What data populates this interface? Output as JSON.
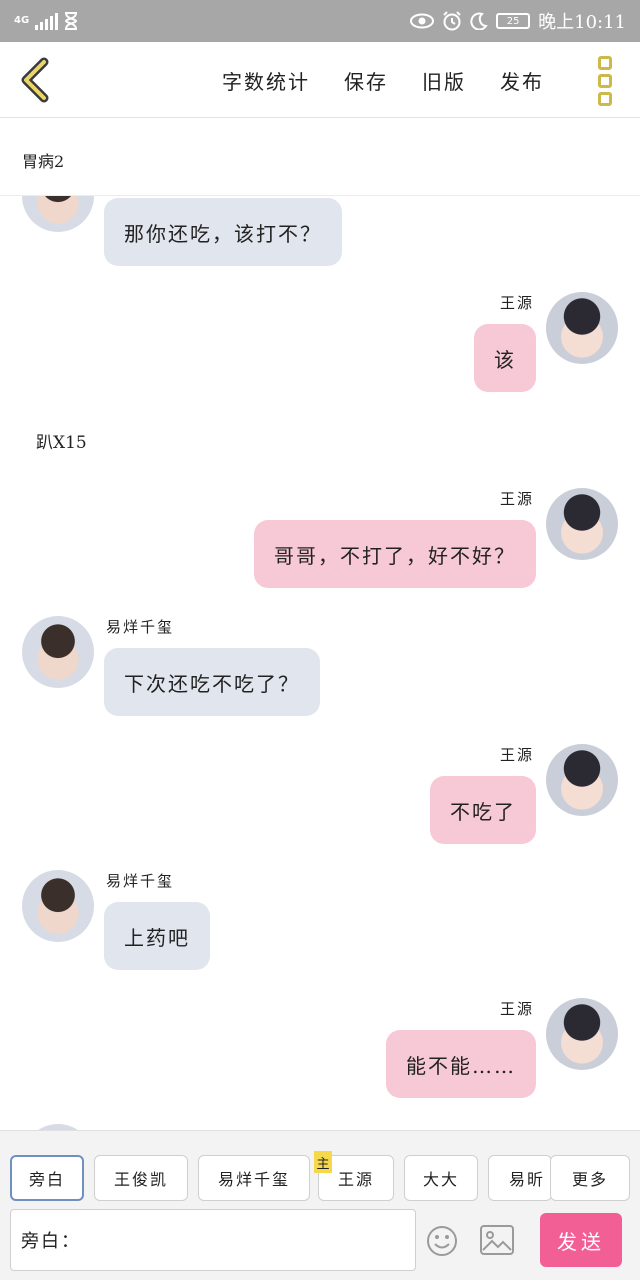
{
  "status_bar": {
    "network": "4G",
    "battery": "25",
    "time": "晚上10:11"
  },
  "header": {
    "links": [
      "字数统计",
      "保存",
      "旧版",
      "发布"
    ]
  },
  "title": "胃病2",
  "messages": [
    {
      "type": "left",
      "speaker": "",
      "text": "那你还吃，该打不？"
    },
    {
      "type": "right",
      "speaker": "王源",
      "text": "该"
    },
    {
      "type": "narration",
      "text": "趴X15"
    },
    {
      "type": "right",
      "speaker": "王源",
      "text": "哥哥，不打了，好不好？"
    },
    {
      "type": "left",
      "speaker": "易烊千玺",
      "text": "下次还吃不吃了？"
    },
    {
      "type": "right",
      "speaker": "王源",
      "text": "不吃了"
    },
    {
      "type": "left",
      "speaker": "易烊千玺",
      "text": "上药吧"
    },
    {
      "type": "right",
      "speaker": "王源",
      "text": "能不能……"
    }
  ],
  "roles": [
    "旁白",
    "王俊凯",
    "易烊千玺",
    "王源",
    "大大",
    "易昕",
    "更多"
  ],
  "main_badge": "主",
  "input_label": "旁白：",
  "send_label": "发送",
  "colors": {
    "left_bubble": "#e1e6ee",
    "right_bubble": "#f7c9d6",
    "send": "#f25f94",
    "accent": "#cdb84a"
  }
}
